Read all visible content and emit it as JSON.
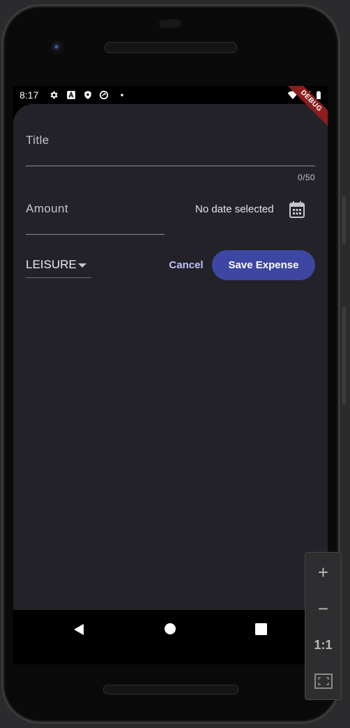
{
  "status_bar": {
    "time": "8:17",
    "left_icons": [
      "gear-icon",
      "font-a-icon",
      "shield-icon",
      "ring-icon",
      "dot-icon"
    ],
    "right_icons": [
      "wifi-icon",
      "signal-icon",
      "battery-icon"
    ]
  },
  "debug_banner": "DEBUG",
  "form": {
    "title": {
      "label": "Title",
      "value": "",
      "counter": "0/50"
    },
    "amount": {
      "label": "Amount",
      "value": ""
    },
    "date": {
      "text": "No date selected",
      "icon": "calendar-icon"
    },
    "category": {
      "selected": "LEISURE",
      "icon": "dropdown-arrow-icon"
    },
    "cancel_label": "Cancel",
    "save_label": "Save Expense"
  },
  "navigation": {
    "buttons": [
      "back-icon",
      "home-icon",
      "recents-icon"
    ]
  },
  "zoom_controls": {
    "zoom_in": "+",
    "zoom_out": "−",
    "actual_size": "1:1",
    "fit_icon": "fit-screen-icon"
  },
  "colors": {
    "sheet_background": "#222228",
    "primary_button": "#3d46a0",
    "text_button": "#bcc2ff",
    "debug_banner": "#8b1d1d"
  }
}
